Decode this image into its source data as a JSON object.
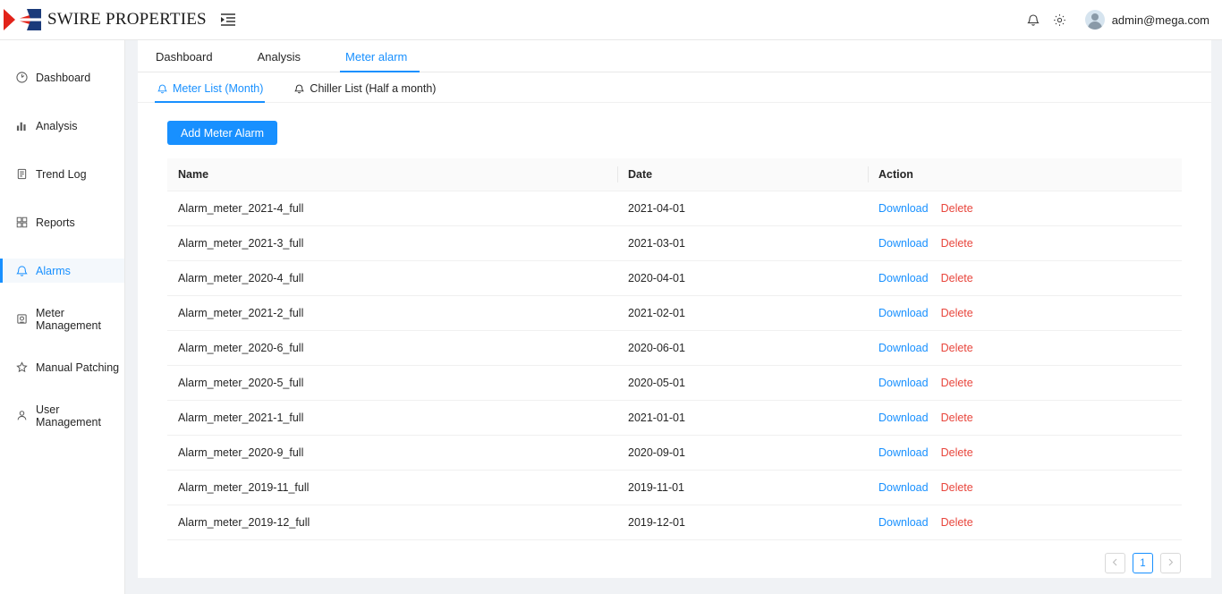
{
  "header": {
    "brand_name": "SWIRE PROPERTIES",
    "menu_toggle_icon": "menu-fold-icon",
    "bell_icon": "bell-icon",
    "gear_icon": "gear-icon",
    "avatar_icon": "user-avatar-icon",
    "user_email": "admin@mega.com"
  },
  "sidebar": {
    "items": [
      {
        "label": "Dashboard",
        "icon": "dashboard-icon",
        "active": false
      },
      {
        "label": "Analysis",
        "icon": "bar-chart-icon",
        "active": false
      },
      {
        "label": "Trend Log",
        "icon": "document-icon",
        "active": false
      },
      {
        "label": "Reports",
        "icon": "report-grid-icon",
        "active": false
      },
      {
        "label": "Alarms",
        "icon": "bell-icon",
        "active": true
      },
      {
        "label": "Meter Management",
        "icon": "meter-icon",
        "active": false
      },
      {
        "label": "Manual Patching",
        "icon": "pin-icon",
        "active": false
      },
      {
        "label": "User Management",
        "icon": "user-icon",
        "active": false
      }
    ]
  },
  "main_tabs": [
    {
      "label": "Dashboard",
      "active": false
    },
    {
      "label": "Analysis",
      "active": false
    },
    {
      "label": "Meter alarm",
      "active": true
    }
  ],
  "sub_tabs": [
    {
      "label": "Meter List (Month)",
      "icon": "bell-icon",
      "active": true
    },
    {
      "label": "Chiller List (Half a month)",
      "icon": "bell-icon",
      "active": false
    }
  ],
  "toolbar": {
    "add_label": "Add Meter Alarm"
  },
  "table": {
    "columns": [
      "Name",
      "Date",
      "Action"
    ],
    "rows": [
      {
        "name": "Alarm_meter_2021-4_full",
        "date": "2021-04-01",
        "download": "Download",
        "delete": "Delete"
      },
      {
        "name": "Alarm_meter_2021-3_full",
        "date": "2021-03-01",
        "download": "Download",
        "delete": "Delete"
      },
      {
        "name": "Alarm_meter_2020-4_full",
        "date": "2020-04-01",
        "download": "Download",
        "delete": "Delete"
      },
      {
        "name": "Alarm_meter_2021-2_full",
        "date": "2021-02-01",
        "download": "Download",
        "delete": "Delete"
      },
      {
        "name": "Alarm_meter_2020-6_full",
        "date": "2020-06-01",
        "download": "Download",
        "delete": "Delete"
      },
      {
        "name": "Alarm_meter_2020-5_full",
        "date": "2020-05-01",
        "download": "Download",
        "delete": "Delete"
      },
      {
        "name": "Alarm_meter_2021-1_full",
        "date": "2021-01-01",
        "download": "Download",
        "delete": "Delete"
      },
      {
        "name": "Alarm_meter_2020-9_full",
        "date": "2020-09-01",
        "download": "Download",
        "delete": "Delete"
      },
      {
        "name": "Alarm_meter_2019-11_full",
        "date": "2019-11-01",
        "download": "Download",
        "delete": "Delete"
      },
      {
        "name": "Alarm_meter_2019-12_full",
        "date": "2019-12-01",
        "download": "Download",
        "delete": "Delete"
      }
    ]
  },
  "pagination": {
    "prev_icon": "chevron-left-icon",
    "next_icon": "chevron-right-icon",
    "current_page": "1"
  },
  "colors": {
    "accent": "#1890ff",
    "danger": "#e8453c",
    "brand_red": "#e2231a",
    "brand_blue": "#1a3a7a",
    "page_bg": "#f0f2f5"
  }
}
